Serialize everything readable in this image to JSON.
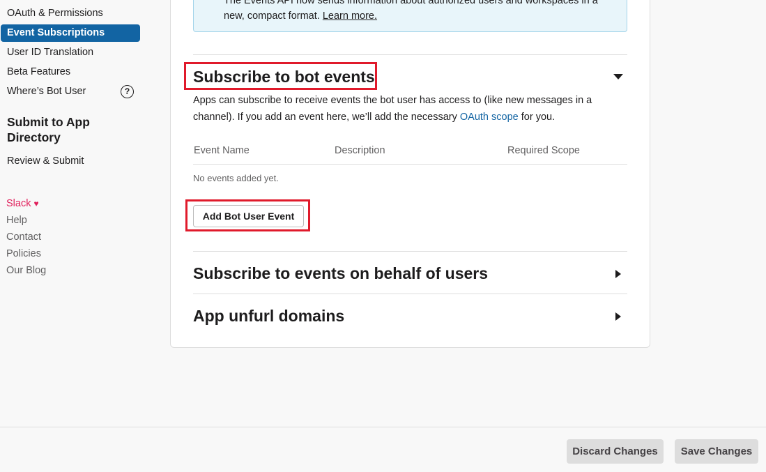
{
  "sidebar": {
    "items": [
      {
        "label": "OAuth & Permissions"
      },
      {
        "label": "Event Subscriptions"
      },
      {
        "label": "User ID Translation"
      },
      {
        "label": "Beta Features"
      },
      {
        "label": "Where’s Bot User"
      }
    ],
    "help_icon": "?",
    "submit_heading": "Submit to App Directory",
    "review_label": "Review & Submit",
    "footer": {
      "slack": "Slack",
      "heart": "♥",
      "help": "Help",
      "contact": "Contact",
      "policies": "Policies",
      "blog": "Our Blog"
    }
  },
  "info": {
    "text": "The Events API now sends information about authorized users and workspaces in a new, compact format.",
    "link": "Learn more."
  },
  "bot_events": {
    "title": "Subscribe to bot events",
    "desc_before": "Apps can subscribe to receive events the bot user has access to (like new messages in a channel). If you add an event here, we’ll add the necessary ",
    "desc_link": "OAuth scope",
    "desc_after": " for you.",
    "columns": [
      "Event Name",
      "Description",
      "Required Scope"
    ],
    "empty": "No events added yet.",
    "add_button": "Add Bot User Event"
  },
  "user_events": {
    "title": "Subscribe to events on behalf of users"
  },
  "unfurl": {
    "title": "App unfurl domains"
  },
  "actions": {
    "discard": "Discard Changes",
    "save": "Save Changes"
  },
  "colors": {
    "accent": "#1264a3",
    "highlight": "#e01a2b",
    "slack_pink": "#e01e5a"
  }
}
